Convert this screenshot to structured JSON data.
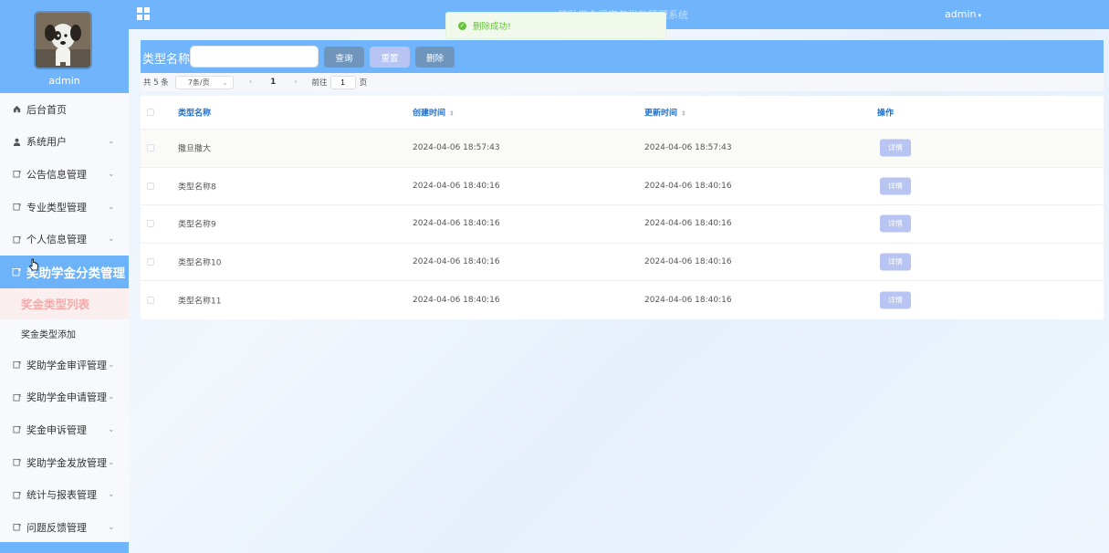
{
  "sidebar": {
    "username": "admin",
    "items": [
      {
        "label": "后台首页",
        "icon": "home-icon"
      },
      {
        "label": "系统用户",
        "icon": "user-icon"
      },
      {
        "label": "公告信息管理",
        "icon": "document-icon"
      },
      {
        "label": "专业类型管理",
        "icon": "document-icon"
      },
      {
        "label": "个人信息管理",
        "icon": "document-icon"
      },
      {
        "label": "奖助学金分类管理",
        "icon": "document-icon"
      },
      {
        "label": "奖助学金审评管理",
        "icon": "document-icon"
      },
      {
        "label": "奖助学金申请管理",
        "icon": "document-icon"
      },
      {
        "label": "奖金申诉管理",
        "icon": "document-icon"
      },
      {
        "label": "奖助学金发放管理",
        "icon": "document-icon"
      },
      {
        "label": "统计与报表管理",
        "icon": "document-icon"
      },
      {
        "label": "问题反馈管理",
        "icon": "document-icon"
      }
    ],
    "sub_items": [
      "奖金类型列表",
      "奖金类型添加"
    ]
  },
  "topbar": {
    "title": "奖助学金评定与发放管理系统",
    "user": "admin"
  },
  "toast": {
    "message": "删除成功!"
  },
  "search": {
    "label": "类型名称",
    "value": "",
    "query_label": "查询",
    "reset_label": "重置",
    "delete_label": "删除"
  },
  "pagination": {
    "total": "共 5 条",
    "page_size": "7条/页",
    "current": "1",
    "goto_label": "前往",
    "jump_value": "1",
    "page_suffix": "页"
  },
  "table": {
    "headers": [
      "类型名称",
      "创建时间",
      "更新时间",
      "操作"
    ],
    "detail_label": "详情",
    "rows": [
      {
        "name": "撒旦撒大",
        "created": "2024-04-06 18:57:43",
        "updated": "2024-04-06 18:57:43"
      },
      {
        "name": "类型名称8",
        "created": "2024-04-06 18:40:16",
        "updated": "2024-04-06 18:40:16"
      },
      {
        "name": "类型名称9",
        "created": "2024-04-06 18:40:16",
        "updated": "2024-04-06 18:40:16"
      },
      {
        "name": "类型名称10",
        "created": "2024-04-06 18:40:16",
        "updated": "2024-04-06 18:40:16"
      },
      {
        "name": "类型名称11",
        "created": "2024-04-06 18:40:16",
        "updated": "2024-04-06 18:40:16"
      }
    ]
  }
}
